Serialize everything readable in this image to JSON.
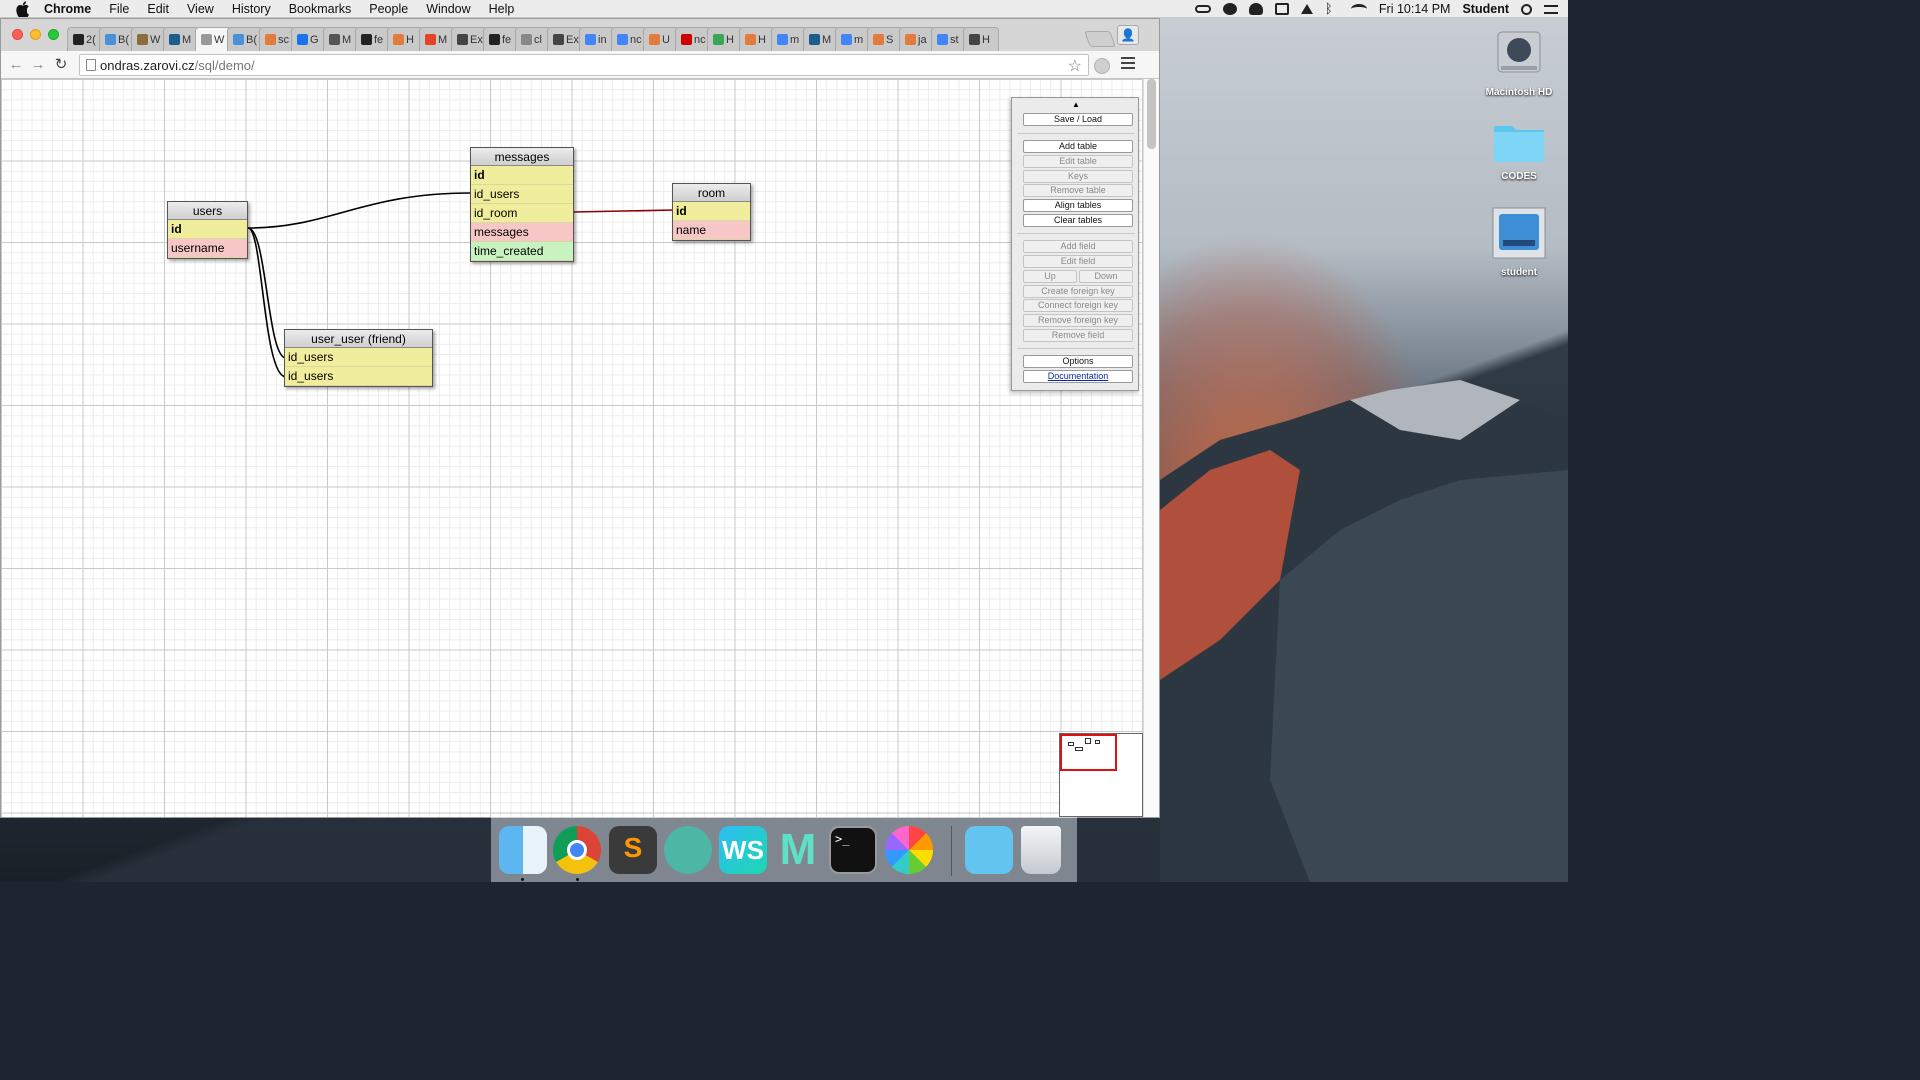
{
  "menubar": {
    "app_name": "Chrome",
    "menus": [
      "File",
      "Edit",
      "View",
      "History",
      "Bookmarks",
      "People",
      "Window",
      "Help"
    ],
    "clock": "Fri 10:14 PM",
    "user": "Student"
  },
  "browser": {
    "tabs": [
      "2(",
      "B(",
      "W",
      "M",
      "W",
      "B(",
      "sc",
      "G",
      "M",
      "fe",
      "H",
      "M",
      "Ex",
      "fe",
      "cl",
      "Ex",
      "in",
      "nc",
      "U",
      "nc",
      "H",
      "H",
      "m",
      "M",
      "m",
      "S",
      "ja",
      "st",
      "H"
    ],
    "active_tab_index": 4,
    "active_tab_close": "×",
    "url_host": "ondras.zarovi.cz",
    "url_path": "/sql/demo/"
  },
  "schema": {
    "tables": {
      "users": {
        "title": "users",
        "fields": [
          "id",
          "username"
        ]
      },
      "messages": {
        "title": "messages",
        "fields": [
          "id",
          "id_users",
          "id_room",
          "messages",
          "time_created"
        ]
      },
      "room": {
        "title": "room",
        "fields": [
          "id",
          "name"
        ]
      },
      "user_user": {
        "title": "user_user (friend)",
        "fields": [
          "id_users",
          "id_users"
        ]
      }
    }
  },
  "panel": {
    "collapse": "▲",
    "save_load": "Save / Load",
    "add_table": "Add table",
    "edit_table": "Edit table",
    "keys": "Keys",
    "remove_table": "Remove table",
    "align_tables": "Align tables",
    "clear_tables": "Clear tables",
    "add_field": "Add field",
    "edit_field": "Edit field",
    "up": "Up",
    "down": "Down",
    "create_fk": "Create foreign key",
    "connect_fk": "Connect foreign key",
    "remove_fk": "Remove foreign key",
    "remove_field": "Remove field",
    "options": "Options",
    "documentation": "Documentation"
  },
  "desktop": {
    "icons": [
      "Macintosh HD",
      "CODES",
      "student"
    ]
  },
  "dock": {
    "apps": [
      "finder-icon",
      "chrome-icon",
      "sublime-icon",
      "atom-icon",
      "webstorm-icon",
      "meteor-icon",
      "terminal-icon",
      "photos-icon",
      "downloads-folder-icon",
      "trash-icon"
    ]
  },
  "colors": {
    "pk_row": "#f0ee9c",
    "text_row": "#f7c7c7",
    "datetime_row": "#c9f2c1",
    "relation_line": "#000000",
    "room_relation_line": "#8b0000"
  }
}
